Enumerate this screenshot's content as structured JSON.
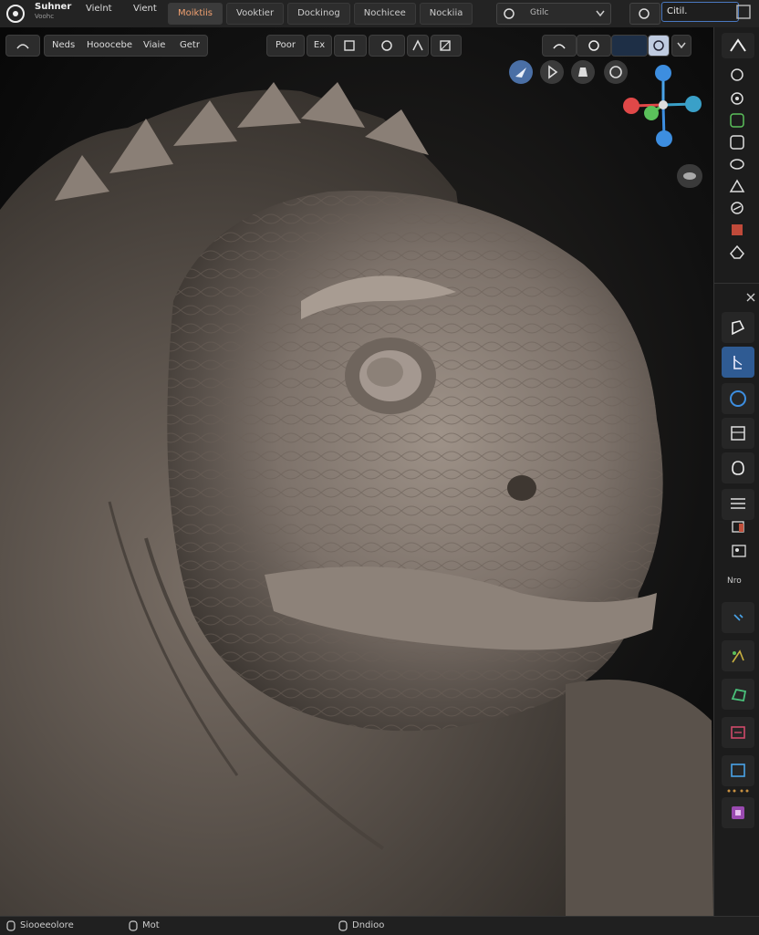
{
  "topbar": {
    "app_title": "Suhner",
    "app_subtitle": "Voohc",
    "menus": [
      "Vielnt",
      "Vient"
    ],
    "workspace_tabs": [
      "Moiktiis",
      "Vooktier",
      "Dockinog",
      "Nochicee",
      "Nockiia"
    ],
    "active_tab": 0,
    "view_select_label": "Gtilc",
    "scene_label": "Citil."
  },
  "header": {
    "items": [
      "Neds",
      "Hooocebe",
      "Viaie",
      "Getr"
    ],
    "mode_label": "Poor",
    "object_label": "Ex"
  },
  "status": {
    "left": "Siooeeolore",
    "mid": "Mot",
    "center": "Dndioo"
  },
  "sidebar": {
    "label": "Nro"
  },
  "colors": {
    "accent": "#4a78c0",
    "active_tool": "#2f5b93",
    "axis_x": "#e04848",
    "axis_y": "#5bc05b",
    "axis_z": "#3d8ee0"
  }
}
